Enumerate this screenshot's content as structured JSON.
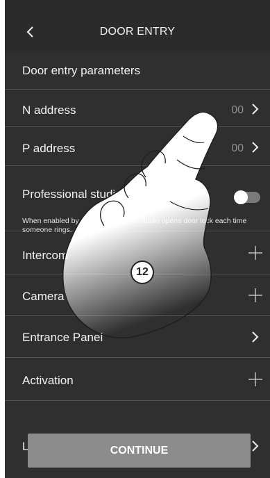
{
  "header": {
    "title": "DOOR ENTRY",
    "back_icon": "chevron-left-icon"
  },
  "section": {
    "title": "Door entry parameters"
  },
  "rows": [
    {
      "label": "N address",
      "value": "00",
      "icon": "chevron-right-icon"
    },
    {
      "label": "P address",
      "value": "00",
      "icon": "chevron-right-icon"
    },
    {
      "label": "Professional studio",
      "description": "When enabled by user, professional studio opens door lock each time someone rings.",
      "toggle_state": "off"
    },
    {
      "label": "Intercom",
      "icon": "plus-icon"
    },
    {
      "label": "Camera",
      "icon": "plus-icon"
    },
    {
      "label": "Entrance Panel",
      "icon": "chevron-right-icon"
    },
    {
      "label": "Activation",
      "icon": "plus-icon"
    },
    {
      "label": "L",
      "icon": "chevron-right-icon"
    }
  ],
  "footer": {
    "continue_label": "CONTINUE"
  },
  "overlay": {
    "step_number": "12"
  },
  "colors": {
    "background": "#2f2f2f",
    "text": "#f2f2f2",
    "divider": "#555555",
    "button": "#8c8c8c"
  }
}
